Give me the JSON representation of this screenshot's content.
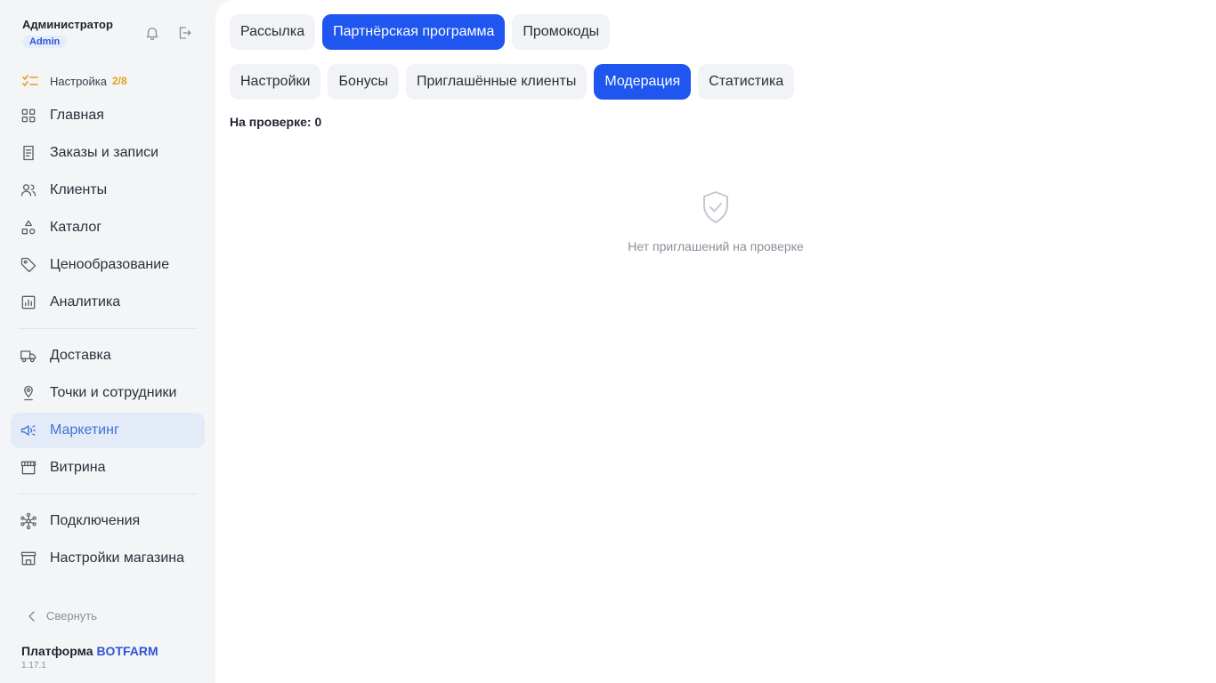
{
  "user": {
    "name": "Администратор",
    "role": "Admin"
  },
  "setup": {
    "label": "Настройка",
    "progress": "2/8"
  },
  "nav": {
    "group1": [
      {
        "label": "Главная",
        "icon": "grid-icon"
      },
      {
        "label": "Заказы и записи",
        "icon": "receipt-icon"
      },
      {
        "label": "Клиенты",
        "icon": "users-icon"
      },
      {
        "label": "Каталог",
        "icon": "shapes-icon"
      },
      {
        "label": "Ценообразование",
        "icon": "tag-icon"
      },
      {
        "label": "Аналитика",
        "icon": "chart-icon"
      }
    ],
    "group2": [
      {
        "label": "Доставка",
        "icon": "truck-icon"
      },
      {
        "label": "Точки и сотрудники",
        "icon": "location-pin-icon"
      },
      {
        "label": "Маркетинг",
        "icon": "megaphone-icon",
        "active": true
      },
      {
        "label": "Витрина",
        "icon": "storefront-icon"
      }
    ],
    "group3": [
      {
        "label": "Подключения",
        "icon": "network-icon"
      },
      {
        "label": "Настройки магазина",
        "icon": "shop-settings-icon"
      }
    ]
  },
  "collapse_label": "Свернуть",
  "platform": {
    "prefix": "Платформа",
    "brand": "BOTFARM",
    "version": "1.17.1"
  },
  "tabs_main": [
    {
      "label": "Рассылка"
    },
    {
      "label": "Партнёрская программа",
      "active": true
    },
    {
      "label": "Промокоды"
    }
  ],
  "tabs_sub": [
    {
      "label": "Настройки"
    },
    {
      "label": "Бонусы"
    },
    {
      "label": "Приглашённые клиенты"
    },
    {
      "label": "Модерация",
      "active": true
    },
    {
      "label": "Статистика"
    }
  ],
  "moderation": {
    "count_label": "На проверке: 0",
    "empty_text": "Нет приглашений на проверке",
    "empty_icon": "shield-check-icon"
  },
  "colors": {
    "accent": "#1f56f0",
    "active_nav_bg": "#e4ebf8",
    "active_nav_text": "#3d71d6",
    "progress": "#e0a21a"
  }
}
